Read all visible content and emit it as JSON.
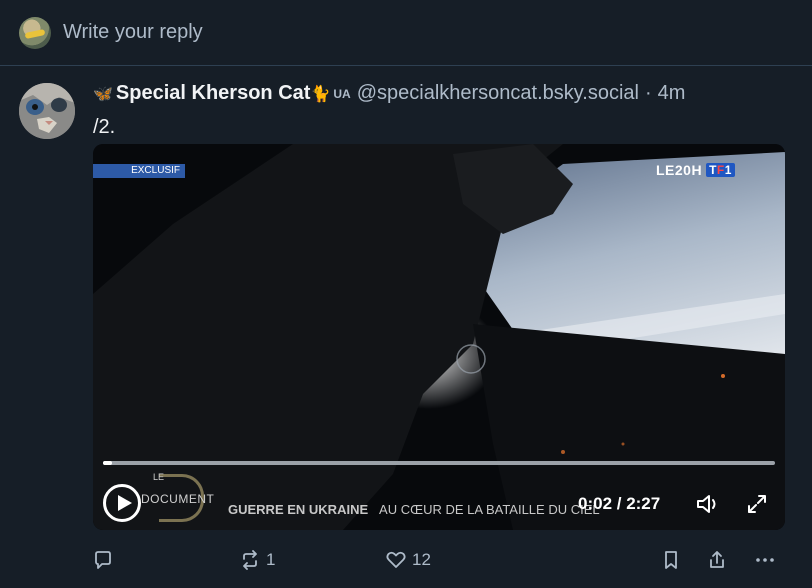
{
  "reply": {
    "placeholder": "Write your reply",
    "avatar_icon": "user-avatar-icon"
  },
  "post": {
    "author_emoji_prefix": "🦋",
    "author_name": "Special Kherson Cat",
    "author_emoji_suffix": "🐈",
    "author_flag": "UA",
    "handle": "@specialkhersoncat.bsky.social",
    "separator": "·",
    "time": "4m",
    "text": "/2."
  },
  "video": {
    "exclusive_label": "EXCLUSIF",
    "channel_label": "LE20H",
    "channel_logo_prefix": "T",
    "channel_logo_red": "F",
    "channel_logo_suffix": "1",
    "doc_logo_top": "LE",
    "doc_logo_word": "DOCUMENT",
    "caption_bold": "GUERRE EN UKRAINE",
    "caption_rest": "AU CŒUR DE LA BATAILLE DU CIEL",
    "timecode": "0:02 / 2:27",
    "progress": 0.014,
    "icons": {
      "play": "play-icon",
      "volume": "volume-icon",
      "fullscreen": "fullscreen-icon"
    }
  },
  "actions": {
    "reply_count": "",
    "repost_count": "1",
    "like_count": "12"
  },
  "colors": {
    "background": "#161e27",
    "muted_text": "#aebbc9",
    "divider": "#2e4052"
  }
}
